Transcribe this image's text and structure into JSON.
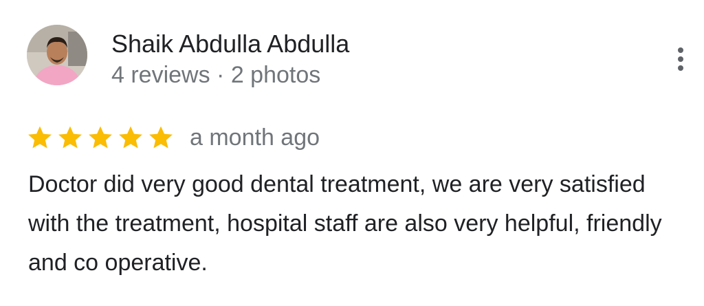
{
  "reviewer": {
    "name": "Shaik Abdulla Abdulla",
    "meta": "4 reviews · 2 photos",
    "avatar_icon": "user-photo-avatar"
  },
  "menu": {
    "icon": "more-vert-icon"
  },
  "rating": {
    "stars": 5,
    "max_stars": 5,
    "star_color": "#fbbc04",
    "time": "a month ago"
  },
  "review": {
    "text": "Doctor did very good dental treatment, we are very satisfied with the treatment, hospital staff are also very helpful, friendly and co operative."
  }
}
